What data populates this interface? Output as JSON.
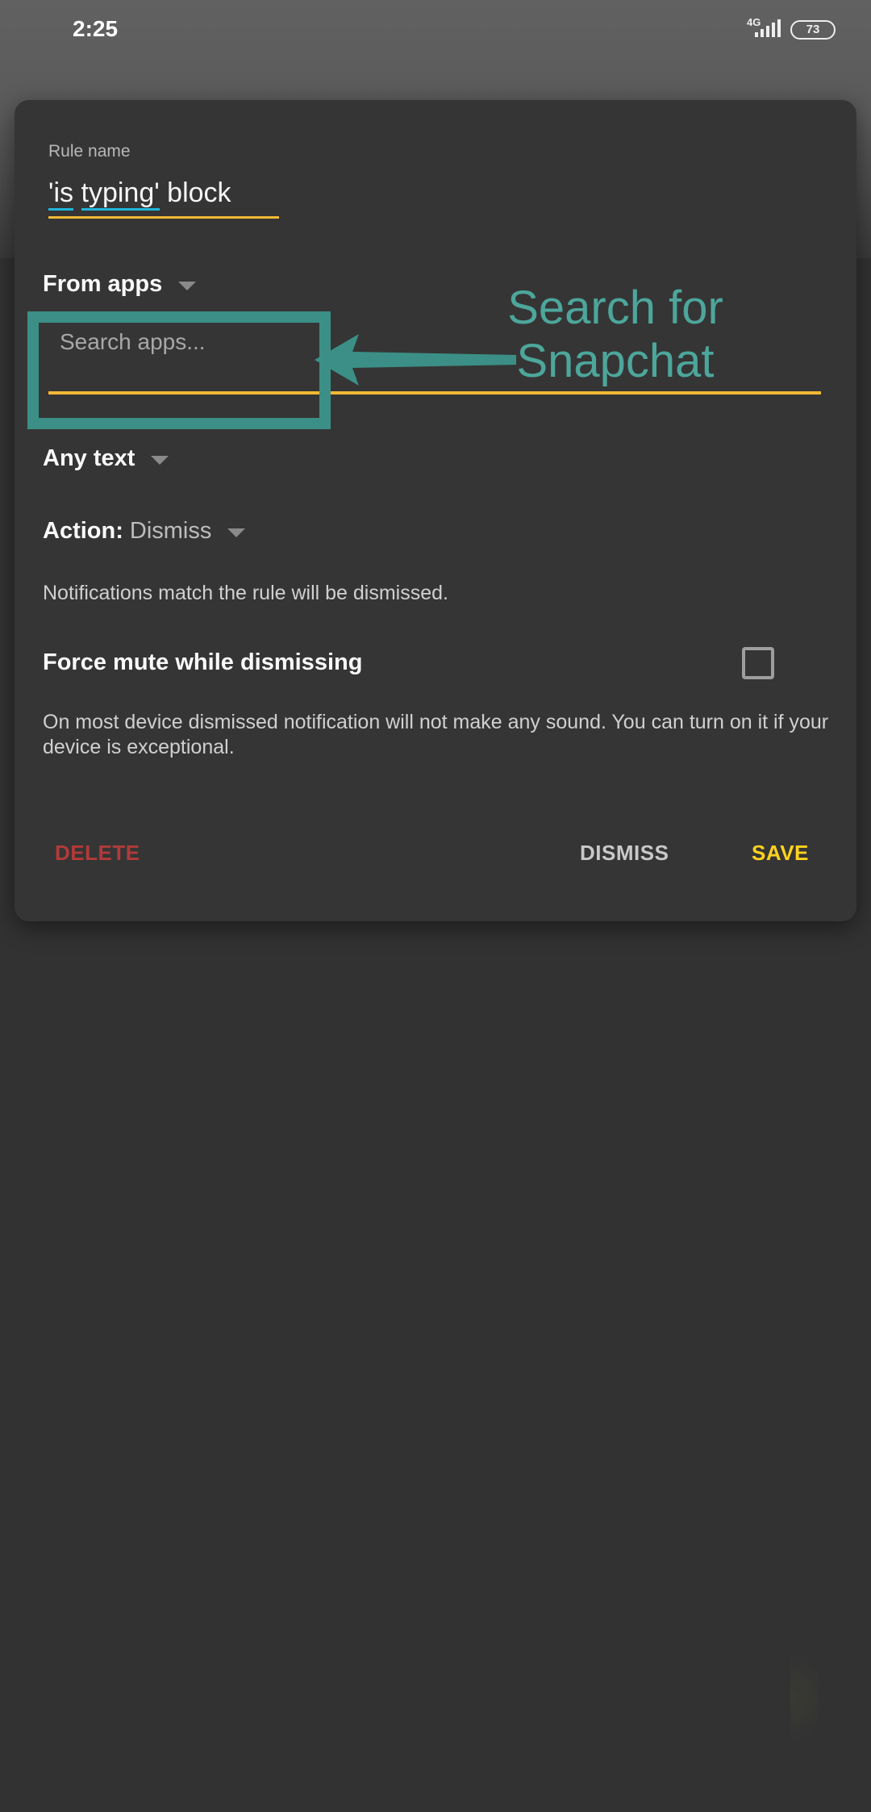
{
  "status_bar": {
    "time": "2:25",
    "network": "4G",
    "battery": "73"
  },
  "dialog": {
    "rule_name_label": "Rule name",
    "rule_name_parts": [
      "'is",
      " ",
      "typing'",
      " block"
    ],
    "from_apps": "From apps",
    "search_placeholder": "Search apps...",
    "any_text": "Any text",
    "action_label": "Action:",
    "action_value": "Dismiss",
    "action_description": "Notifications match the rule will be dismissed.",
    "force_mute_label": "Force mute while dismissing",
    "force_mute_checked": false,
    "force_mute_description": "On most device dismissed notification will not make any sound. You can turn on it if your device is exceptional.",
    "buttons": {
      "delete": "DELETE",
      "dismiss": "DISMISS",
      "save": "SAVE"
    }
  },
  "annotation": {
    "text_line1": "Search for",
    "text_line2": "Snapchat"
  },
  "colors": {
    "accent_underline": "#f2b933",
    "spellcheck": "#1eb6d9",
    "annotation": "#3b8f86",
    "delete": "#b23a3a",
    "save": "#ffd21f"
  }
}
